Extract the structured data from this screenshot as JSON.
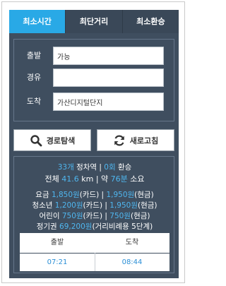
{
  "tabs": [
    {
      "label": "최소시간",
      "active": true
    },
    {
      "label": "최단거리",
      "active": false
    },
    {
      "label": "최소환승",
      "active": false
    }
  ],
  "form": {
    "origin_label": "출발",
    "origin_value": "가능",
    "via_label": "경유",
    "via_value": "",
    "dest_label": "도착",
    "dest_value": "가산디지털단지"
  },
  "buttons": {
    "search": "경로탐색",
    "refresh": "새로고침"
  },
  "summary": {
    "stations_count": "33개",
    "stations_text": " 정차역 | ",
    "transfers_count": "0회",
    "transfers_text": " 환승",
    "total_label": "전체 ",
    "distance": "41.6",
    "distance_unit": " km | 약 ",
    "minutes": "76분",
    "minutes_text": " 소요"
  },
  "fares": {
    "adult_label": "요금 ",
    "adult_card": "1,850원",
    "adult_card_suffix": "(카드) | ",
    "adult_cash": "1,950원",
    "adult_cash_suffix": "(현금)",
    "youth_label": "청소년 ",
    "youth_card": "1,200원",
    "youth_card_suffix": "(카드) | ",
    "youth_cash": "1,950원",
    "youth_cash_suffix": "(현금)",
    "child_label": "어린이 ",
    "child_card": "750원",
    "child_card_suffix": "(카드) | ",
    "child_cash": "750원",
    "child_cash_suffix": "(현금)",
    "pass_label": "정기권 ",
    "pass_value": "69,200원",
    "pass_suffix": "(거리비례용 5단계)"
  },
  "times": {
    "depart_header": "출발",
    "arrive_header": "도착",
    "depart_time": "07:21",
    "arrive_time": "08:44"
  },
  "colors": {
    "panel": "#3f4e5f",
    "accent": "#29a9e6",
    "highlight": "#4fb6ef"
  }
}
